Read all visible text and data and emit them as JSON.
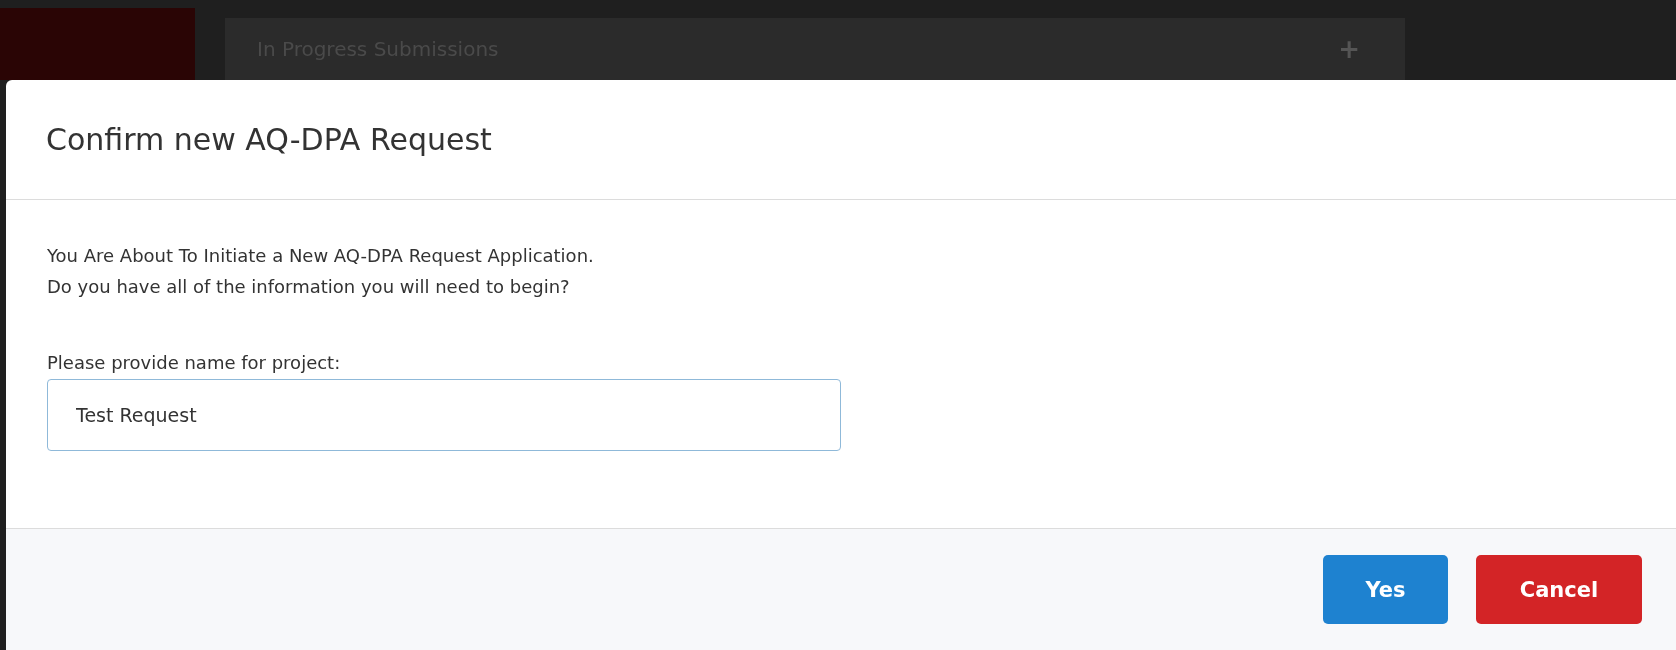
{
  "background": {
    "panel_title": "In Progress Submissions",
    "panel_button": "+"
  },
  "dialog": {
    "title": "Confirm new AQ-DPA Request",
    "message_lines": [
      "You Are About To Initiate a New AQ-DPA Request Application.",
      "Do you have all of the information you will need to begin?"
    ],
    "field_label": "Please provide name for project:",
    "field_value": "Test Request",
    "buttons": [
      {
        "label": "Yes",
        "kind": "primary"
      },
      {
        "label": "Cancel",
        "kind": "danger"
      }
    ]
  }
}
